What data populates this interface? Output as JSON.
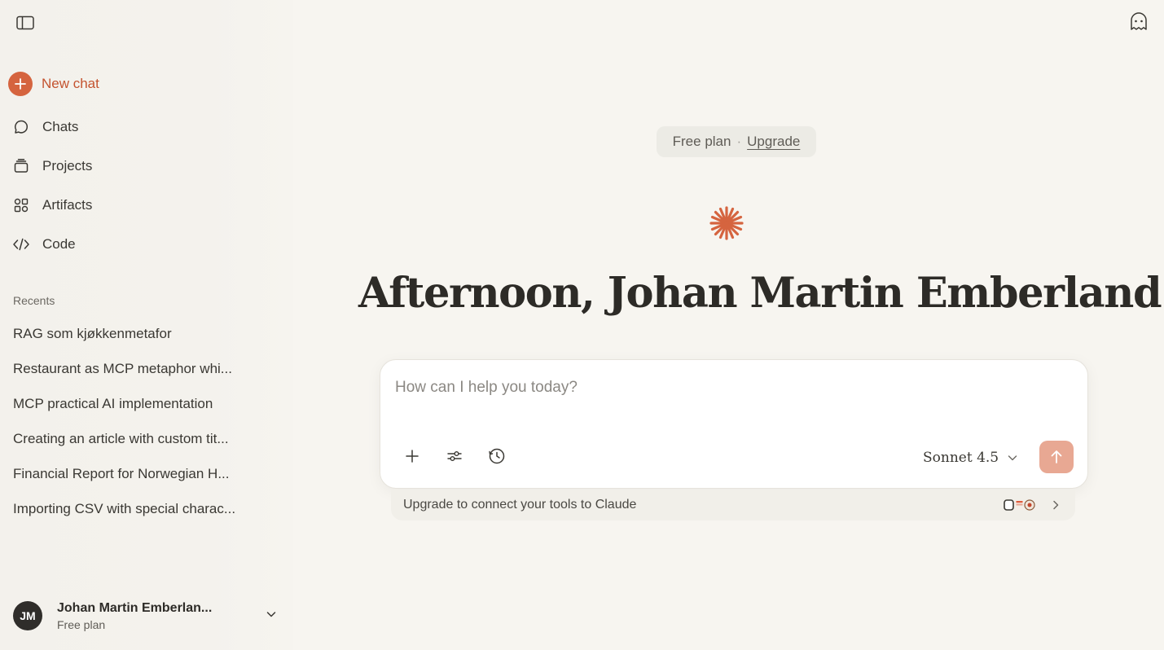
{
  "sidebar": {
    "new_chat": "New chat",
    "nav": [
      {
        "label": "Chats",
        "icon": "chat-bubble-icon"
      },
      {
        "label": "Projects",
        "icon": "folder-stack-icon"
      },
      {
        "label": "Artifacts",
        "icon": "shapes-icon"
      },
      {
        "label": "Code",
        "icon": "code-icon"
      }
    ],
    "recents_label": "Recents",
    "recents": [
      "RAG som kjøkkenmetafor",
      "Restaurant as MCP metaphor whi...",
      "MCP practical AI implementation",
      "Creating an article with custom tit...",
      "Financial Report for Norwegian H...",
      "Importing CSV with special charac..."
    ],
    "user": {
      "initials": "JM",
      "name": "Johan Martin Emberlan...",
      "plan": "Free plan"
    }
  },
  "main": {
    "plan_pill": {
      "plan": "Free plan",
      "separator": "·",
      "upgrade": "Upgrade"
    },
    "greeting": "Afternoon, Johan Martin Emberland",
    "composer": {
      "placeholder": "How can I help you today?",
      "model": "Sonnet 4.5"
    },
    "connect_text": "Upgrade to connect your tools to Claude"
  },
  "colors": {
    "accent": "#d5643f",
    "send_button": "#e8a893",
    "background": "#f7f5f0"
  }
}
